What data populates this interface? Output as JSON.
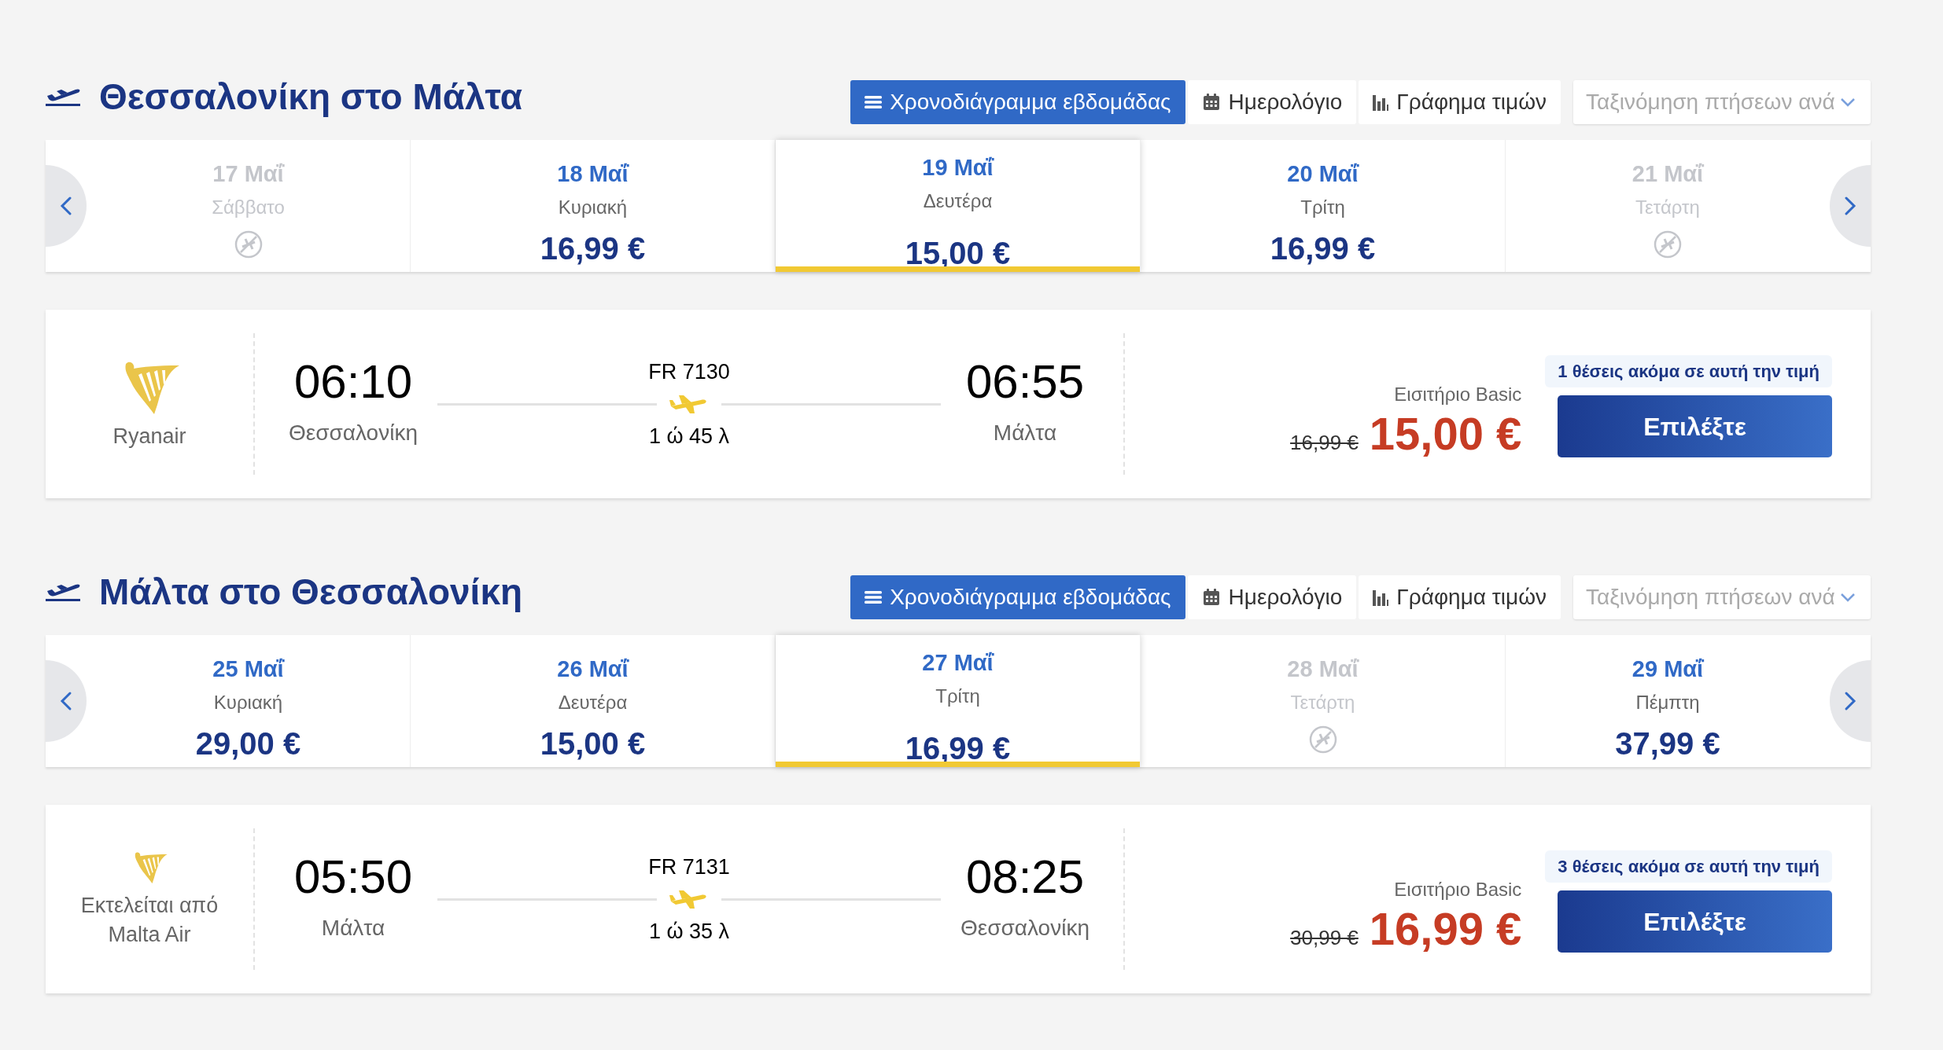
{
  "sections": [
    {
      "title": "Θεσσαλονίκη στο Μάλτα",
      "view_tabs": [
        {
          "label": "Χρονοδιάγραμμα εβδομάδας",
          "kind": "list",
          "selected": true
        },
        {
          "label": "Ημερολόγιο",
          "kind": "calendar",
          "selected": false
        },
        {
          "label": "Γράφημα τιμών",
          "kind": "chart",
          "selected": false
        }
      ],
      "sort": {
        "placeholder": "Ταξινόμηση πτήσεων ανά"
      },
      "dates": [
        {
          "date": "17 Μαΐ",
          "day": "Σάββατο",
          "available": false,
          "selected": false
        },
        {
          "date": "18 Μαΐ",
          "day": "Κυριακή",
          "price": "16,99 €",
          "available": true,
          "selected": false
        },
        {
          "date": "19 Μαΐ",
          "day": "Δευτέρα",
          "price": "15,00 €",
          "available": true,
          "selected": true
        },
        {
          "date": "20 Μαΐ",
          "day": "Τρίτη",
          "price": "16,99 €",
          "available": true,
          "selected": false
        },
        {
          "date": "21 Μαΐ",
          "day": "Τετάρτη",
          "available": false,
          "selected": false
        }
      ],
      "flight": {
        "carrier": "Ryanair",
        "depart_time": "06:10",
        "depart_city": "Θεσσαλονίκη",
        "flight_number": "FR 7130",
        "duration": "1 ώ 45 λ",
        "arrive_time": "06:55",
        "arrive_city": "Μάλτα",
        "seats_badge": "1 θέσεις ακόμα σε αυτή την τιμή",
        "fare": "Εισιτήριο Basic",
        "old_price": "16,99 €",
        "price": "15,00 €",
        "button": "Επιλέξτε"
      }
    },
    {
      "title": "Μάλτα στο Θεσσαλονίκη",
      "view_tabs": [
        {
          "label": "Χρονοδιάγραμμα εβδομάδας",
          "kind": "list",
          "selected": true
        },
        {
          "label": "Ημερολόγιο",
          "kind": "calendar",
          "selected": false
        },
        {
          "label": "Γράφημα τιμών",
          "kind": "chart",
          "selected": false
        }
      ],
      "sort": {
        "placeholder": "Ταξινόμηση πτήσεων ανά"
      },
      "dates": [
        {
          "date": "25 Μαΐ",
          "day": "Κυριακή",
          "price": "29,00 €",
          "available": true,
          "selected": false
        },
        {
          "date": "26 Μαΐ",
          "day": "Δευτέρα",
          "price": "15,00 €",
          "available": true,
          "selected": false
        },
        {
          "date": "27 Μαΐ",
          "day": "Τρίτη",
          "price": "16,99 €",
          "available": true,
          "selected": true
        },
        {
          "date": "28 Μαΐ",
          "day": "Τετάρτη",
          "available": false,
          "selected": false
        },
        {
          "date": "29 Μαΐ",
          "day": "Πέμπτη",
          "price": "37,99 €",
          "available": true,
          "selected": false
        }
      ],
      "flight": {
        "carrier": "Εκτελείται από Malta Air",
        "depart_time": "05:50",
        "depart_city": "Μάλτα",
        "flight_number": "FR 7131",
        "duration": "1 ώ 35 λ",
        "arrive_time": "08:25",
        "arrive_city": "Θεσσαλονίκη",
        "seats_badge": "3 θέσεις ακόμα σε αυτή την τιμή",
        "fare": "Εισιτήριο Basic",
        "old_price": "30,99 €",
        "price": "16,99 €",
        "button": "Επιλέξτε"
      }
    }
  ]
}
